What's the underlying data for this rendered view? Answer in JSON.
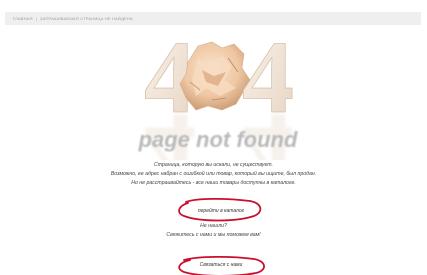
{
  "breadcrumb": {
    "home": "ГЛАВНАЯ",
    "separator": "|",
    "current": "ЗАПРАШИВАЕМАЯ СТРАНИЦА НЕ НАЙДЕНА"
  },
  "hero": {
    "digit_left": "4",
    "digit_right": "4",
    "caption": "page not found",
    "center_image": "crumpled-paper-ball"
  },
  "message": {
    "line1": "Страница, которую вы искали, не существует.",
    "line2": "Возможно, ее адрес набран с ошибкой или товар, который вы ищите, был продан.",
    "line3": "Но не расстраивайтесь - все наши товары доступны в каталоге."
  },
  "catalog_link": "перейти в каталог",
  "not_found": {
    "line1": "Не нашли?",
    "line2": "Свяжитесь с нами и мы поможем вам!"
  },
  "contact_link": "Связаться с нами",
  "colors": {
    "accent_red": "#c8102e",
    "digit_fill": "#f3e7da",
    "paper": "#efc7a3"
  }
}
